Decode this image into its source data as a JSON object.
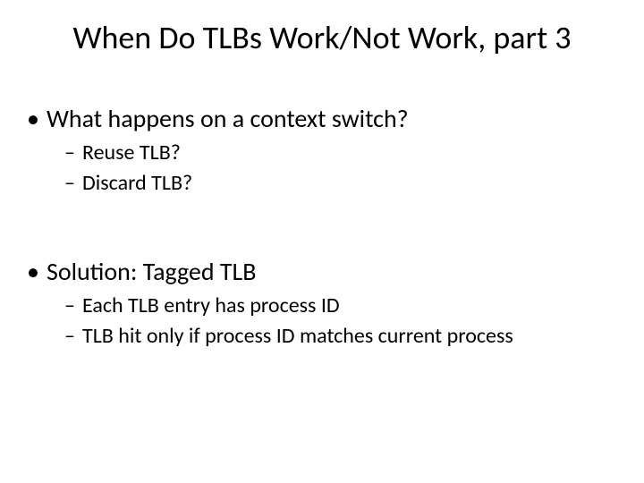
{
  "title": "When Do TLBs Work/Not Work, part 3",
  "points": {
    "q": "What happens on a context switch?",
    "q_sub1": "Reuse TLB?",
    "q_sub2": "Discard TLB?",
    "sol": "Solution: Tagged TLB",
    "sol_sub1": "Each TLB entry has process ID",
    "sol_sub2": "TLB hit only if process ID matches current process"
  }
}
